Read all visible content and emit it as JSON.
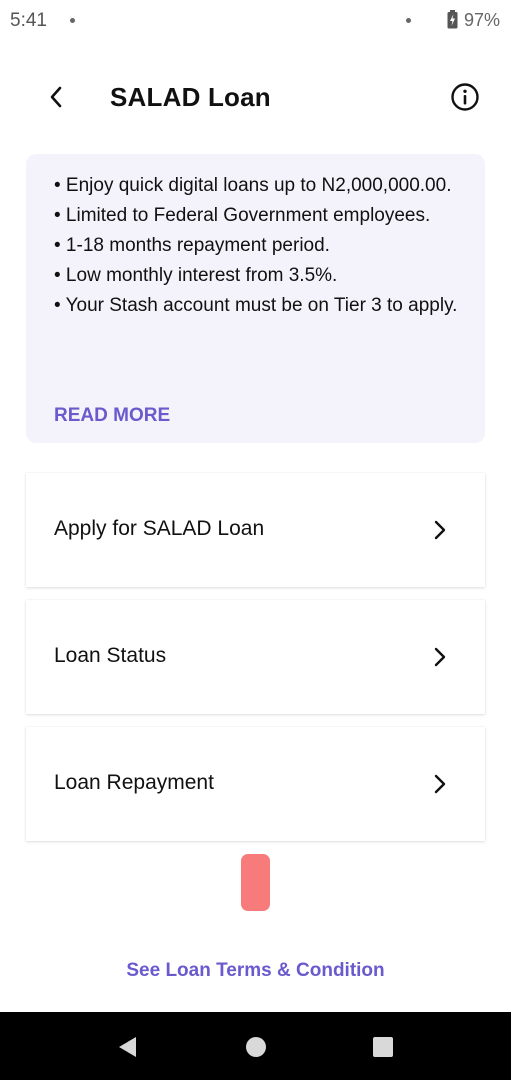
{
  "status_bar": {
    "time": "5:41",
    "battery": "97%",
    "icons": [
      "notification-dot-icon",
      "notification-dot-icon",
      "battery-icon"
    ]
  },
  "header": {
    "title": "SALAD Loan",
    "back_icon": "chevron-left-icon",
    "info_icon": "info-circle-icon"
  },
  "info_card": {
    "bullets": [
      "• Enjoy quick digital loans up to N2,000,000.00.",
      "• Limited to Federal Government employees.",
      "• 1-18 months repayment period.",
      "• Low monthly interest from 3.5%.",
      "• Your Stash account must be on Tier 3 to apply."
    ],
    "read_more": "READ MORE"
  },
  "menu": [
    {
      "label": "Apply for SALAD Loan",
      "icon": "chevron-right-icon"
    },
    {
      "label": "Loan Status",
      "icon": "chevron-right-icon"
    },
    {
      "label": "Loan Repayment",
      "icon": "chevron-right-icon"
    }
  ],
  "terms_link": "See Loan Terms & Condition",
  "nav_bar": {
    "icons": [
      "back-triangle-icon",
      "home-circle-icon",
      "recents-square-icon"
    ]
  },
  "colors": {
    "accent": "#6a5acd",
    "card_background": "#f4f3fb",
    "pill": "#f77b7b",
    "nav_bar": "#000000"
  }
}
